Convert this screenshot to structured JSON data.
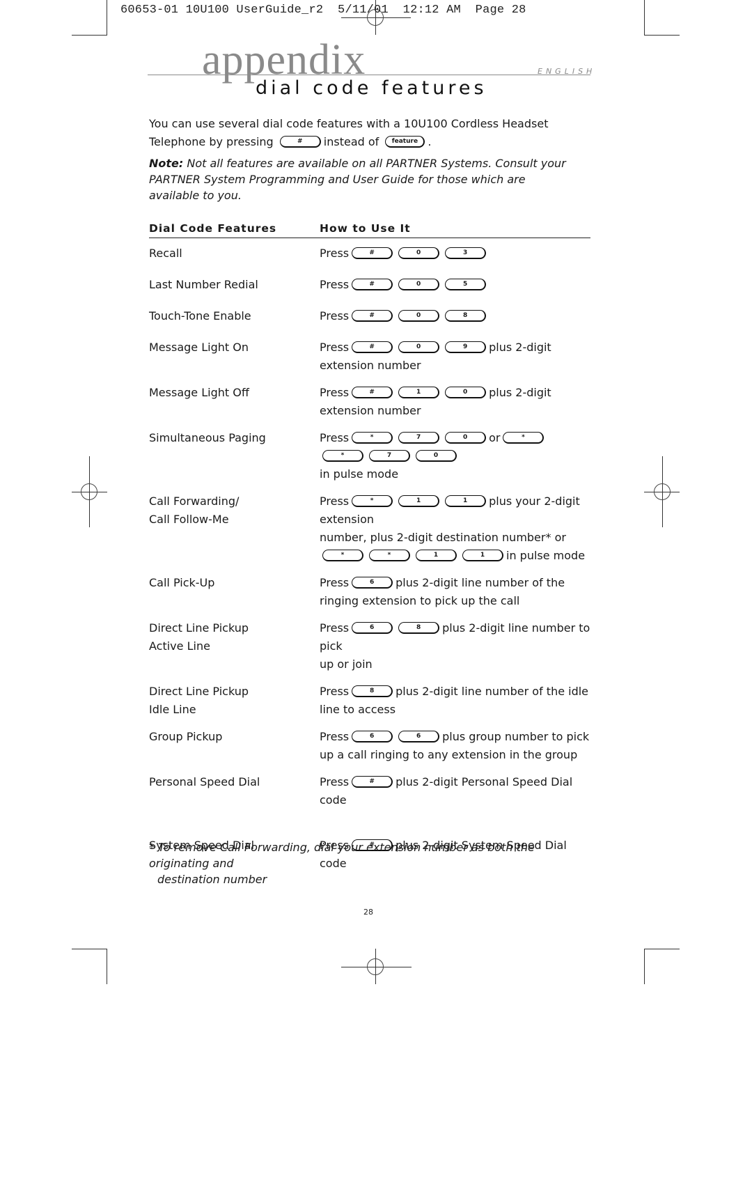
{
  "slug": "60653-01 10U100 UserGuide_r2  5/11/01  12:12 AM  Page 28",
  "header": {
    "section": "appendix",
    "language": "ENGLISH",
    "title": "dial code features"
  },
  "intro": {
    "text_before": "You can use several dial code features with a 10U100 Cordless Headset Telephone by pressing",
    "key_hash": "#",
    "text_middle": "instead of",
    "key_feature": "feature",
    "text_after": "."
  },
  "note": {
    "label": "Note:",
    "text": "Not all features are available on all PARTNER Systems. Consult your PARTNER System Programming and User Guide for those which are available to you."
  },
  "table": {
    "headers": [
      "Dial Code Features",
      "How to Use It"
    ],
    "press_label": "Press",
    "rows": [
      {
        "feature": [
          "Recall"
        ],
        "keys": [
          "#",
          "0",
          "3"
        ],
        "text": "",
        "line2": ""
      },
      {
        "feature": [
          "Last Number Redial"
        ],
        "keys": [
          "#",
          "0",
          "5"
        ],
        "text": "",
        "line2": ""
      },
      {
        "feature": [
          "Touch-Tone Enable"
        ],
        "keys": [
          "#",
          "0",
          "8"
        ],
        "text": "",
        "line2": ""
      },
      {
        "feature": [
          "Message Light On"
        ],
        "keys": [
          "#",
          "0",
          "9"
        ],
        "text": "plus 2-digit",
        "line2": "extension number"
      },
      {
        "feature": [
          "Message Light Off"
        ],
        "keys": [
          "#",
          "1",
          "0"
        ],
        "text": "plus 2-digit",
        "line2": "extension number"
      },
      {
        "feature": [
          "Simultaneous Paging"
        ],
        "keys": [
          "*",
          "7",
          "0"
        ],
        "or_label": "or",
        "alt_keys": [
          "*",
          "*",
          "7",
          "0"
        ],
        "text": "",
        "line2": "in pulse mode"
      },
      {
        "feature": [
          "Call Forwarding/",
          "Call Follow-Me"
        ],
        "keys": [
          "*",
          "1",
          "1"
        ],
        "text": "plus your 2-digit extension",
        "line2": "number, plus 2-digit destination number* or",
        "line3_keys": [
          "*",
          "*",
          "1",
          "1"
        ],
        "line3_text": "in pulse mode"
      },
      {
        "feature": [
          "Call Pick-Up"
        ],
        "keys": [
          "6"
        ],
        "text": "plus 2-digit line number of the",
        "line2": "ringing extension to pick up the call"
      },
      {
        "feature": [
          "Direct Line Pickup",
          "Active Line"
        ],
        "keys": [
          "6",
          "8"
        ],
        "text": "plus 2-digit line number to pick",
        "line2": "up or join"
      },
      {
        "feature": [
          "Direct Line Pickup",
          "Idle Line"
        ],
        "keys": [
          "8"
        ],
        "text": "plus 2-digit line number of the idle",
        "line2": "line to access"
      },
      {
        "feature": [
          "Group Pickup"
        ],
        "keys": [
          "6",
          "6"
        ],
        "text": "plus group number to pick",
        "line2": "up a call ringing to any extension in the group"
      },
      {
        "feature": [
          "Personal Speed Dial"
        ],
        "keys": [
          "#"
        ],
        "text": "plus 2-digit Personal Speed Dial code",
        "line2": ""
      },
      {
        "feature": [
          "System Speed Dial"
        ],
        "keys": [
          "#"
        ],
        "text": "plus 2-digit System Speed Dial code",
        "line2": ""
      }
    ]
  },
  "footnote": {
    "line1": "* To remove Call Forwarding, dial your extension number as both the originating and",
    "line2": "destination number"
  },
  "page_number": "28"
}
